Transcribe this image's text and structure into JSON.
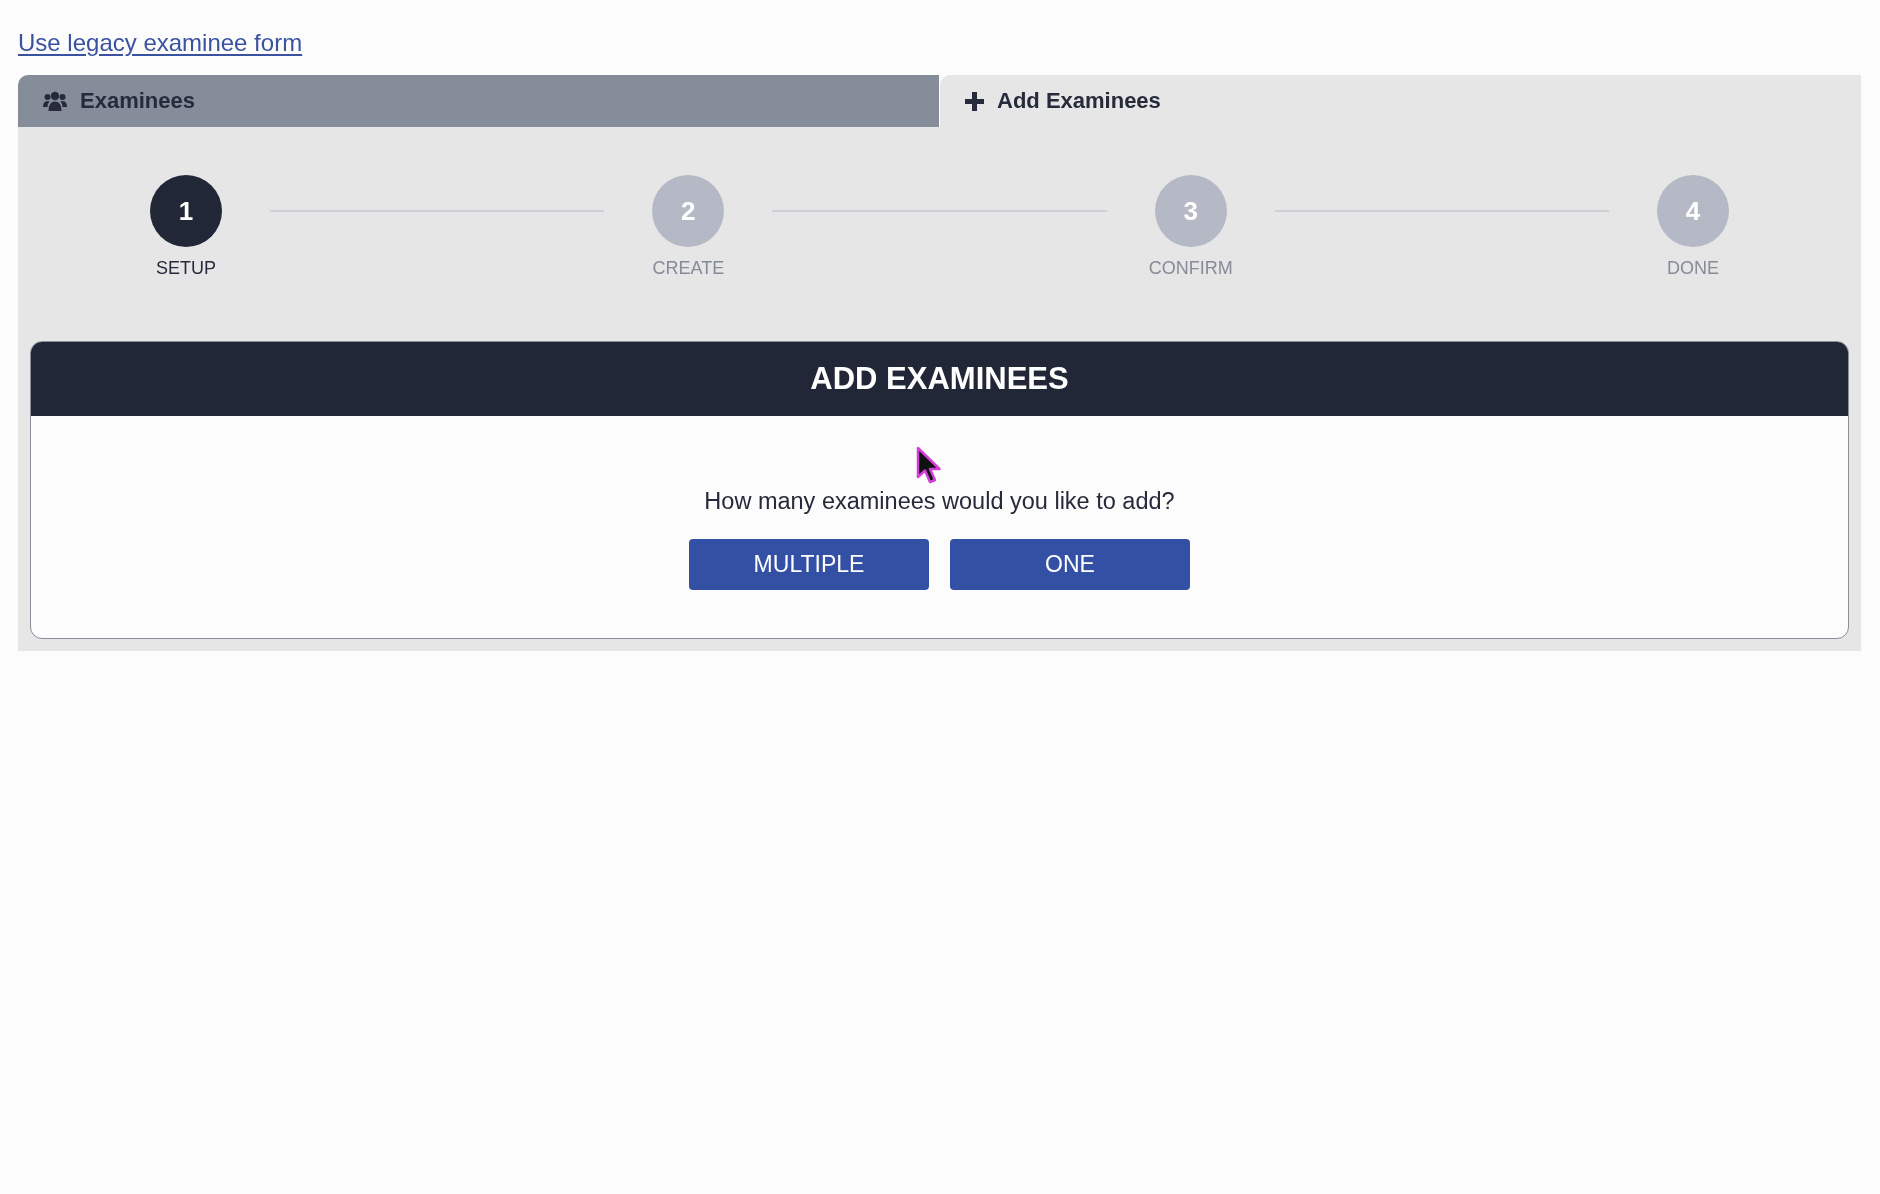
{
  "link": {
    "text": "Use legacy examinee form"
  },
  "tabs": [
    {
      "label": "Examinees",
      "selected": false
    },
    {
      "label": "Add Examinees",
      "selected": true
    }
  ],
  "steps": [
    {
      "number": "1",
      "label": "SETUP",
      "selected": true
    },
    {
      "number": "2",
      "label": "CREATE",
      "selected": false
    },
    {
      "number": "3",
      "label": "CONFIRM",
      "selected": false
    },
    {
      "number": "4",
      "label": "DONE",
      "selected": false
    }
  ],
  "card": {
    "title": "ADD EXAMINEES",
    "question": "How many examinees would you like to add?",
    "buttons": [
      "MULTIPLE",
      "ONE"
    ]
  }
}
